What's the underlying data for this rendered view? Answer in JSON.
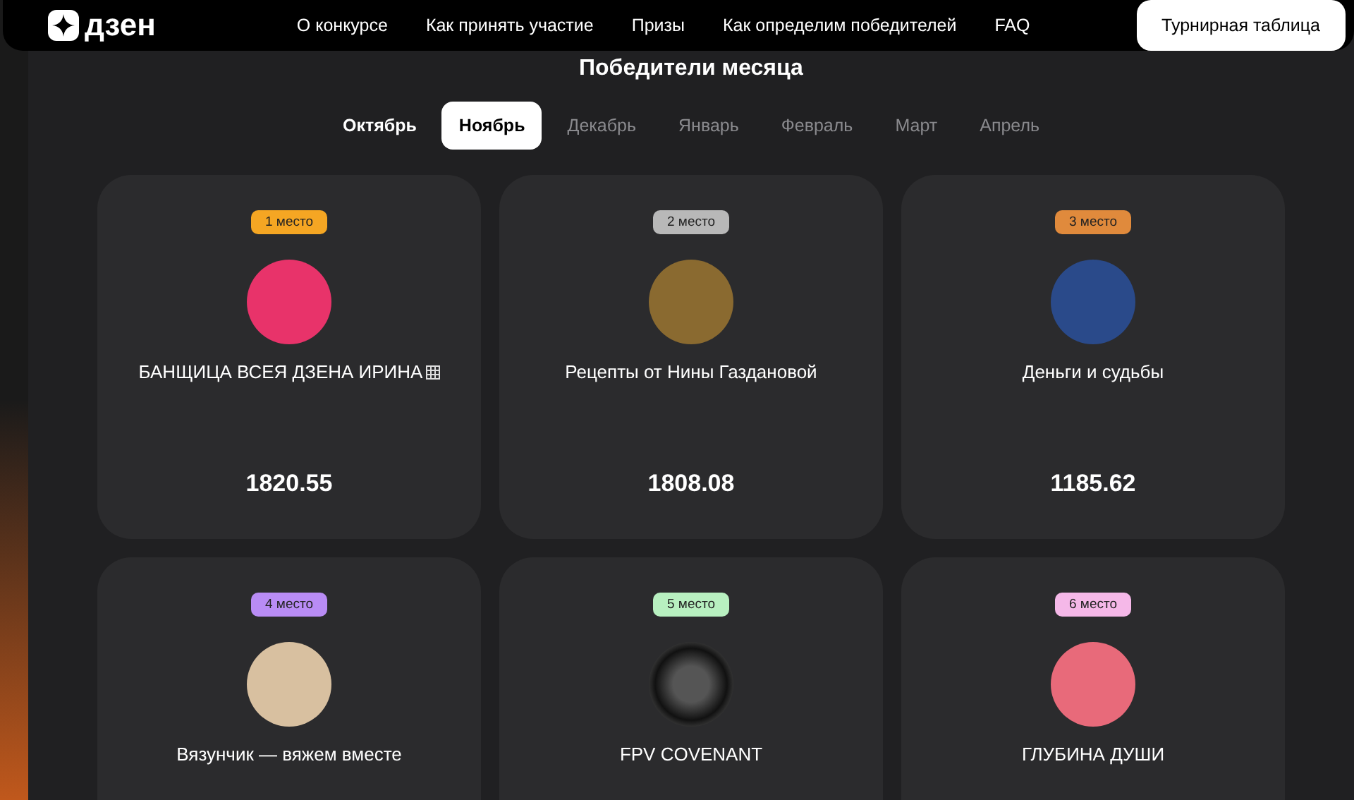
{
  "header": {
    "logo": "дзен",
    "nav": [
      "О конкурсе",
      "Как принять участие",
      "Призы",
      "Как определим победителей",
      "FAQ"
    ],
    "button": "Турнирная таблица"
  },
  "title": "Победители месяца",
  "tabs": [
    {
      "label": "Октябрь",
      "selected": false,
      "disabled": false
    },
    {
      "label": "Ноябрь",
      "selected": true,
      "disabled": false
    },
    {
      "label": "Декабрь",
      "selected": false,
      "disabled": true
    },
    {
      "label": "Январь",
      "selected": false,
      "disabled": true
    },
    {
      "label": "Февраль",
      "selected": false,
      "disabled": true
    },
    {
      "label": "Март",
      "selected": false,
      "disabled": true
    },
    {
      "label": "Апрель",
      "selected": false,
      "disabled": true
    }
  ],
  "cards": [
    {
      "place": "1 место",
      "color": "#f5a623",
      "name": "БАНЩИЦА ВСЕЯ ДЗЕНА ИРИНА",
      "tofu": true,
      "score": "1820.55"
    },
    {
      "place": "2 место",
      "color": "#b8b8b8",
      "name": "Рецепты от Нины Газдановой",
      "tofu": false,
      "score": "1808.08"
    },
    {
      "place": "3 место",
      "color": "#e08a3c",
      "name": "Деньги и судьбы",
      "tofu": false,
      "score": "1185.62"
    },
    {
      "place": "4 место",
      "color": "#b98cf5",
      "name": "Вязунчик — вяжем вместе",
      "tofu": false
    },
    {
      "place": "5 место",
      "color": "#b8f0c0",
      "name": "FPV COVENANT",
      "tofu": false
    },
    {
      "place": "6 место",
      "color": "#f5b8e8",
      "name": "ГЛУБИНА ДУШИ",
      "tofu": false
    }
  ]
}
